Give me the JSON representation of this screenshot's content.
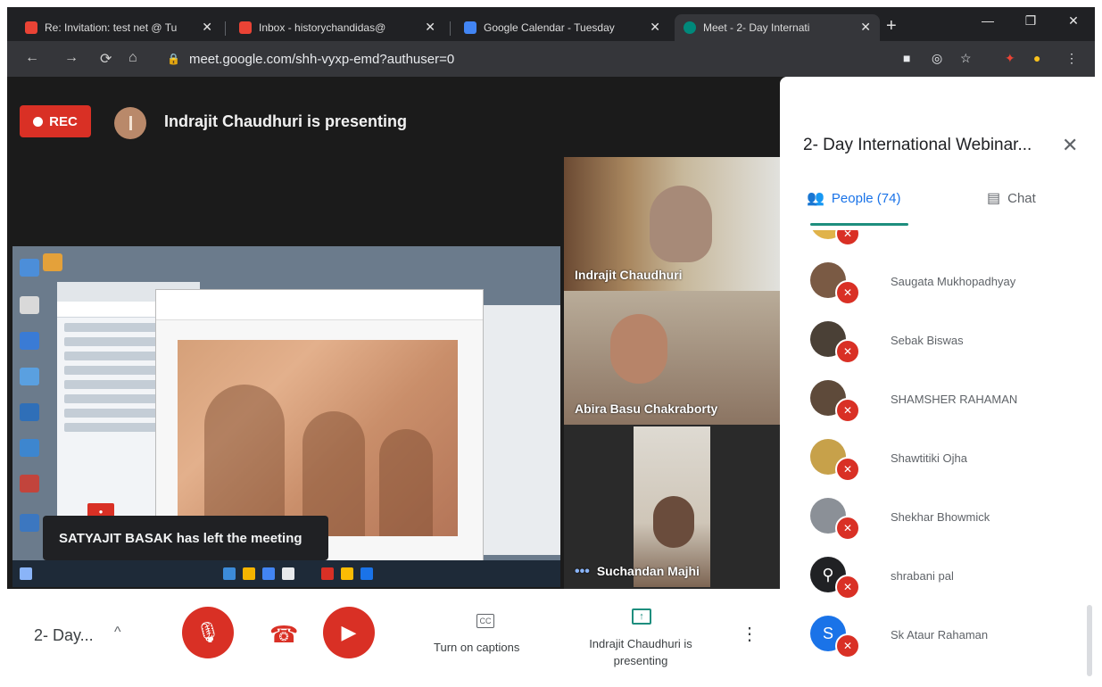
{
  "browser": {
    "tabs": [
      {
        "title": "Re: Invitation: test net @ Tu",
        "icon": "gmail-icon",
        "color": "#ea4335"
      },
      {
        "title": "Inbox - historychandidas@",
        "icon": "gmail-icon",
        "color": "#ea4335"
      },
      {
        "title": "Google Calendar - Tuesday",
        "icon": "calendar-icon",
        "color": "#4285f4"
      },
      {
        "title": "Meet - 2- Day Internati",
        "icon": "meet-icon",
        "color": "#00897b"
      }
    ],
    "url": "meet.google.com/shh-vyxp-emd?authuser=0"
  },
  "meet": {
    "rec_label": "REC",
    "presenting_banner": "Indrajit Chaudhuri is presenting",
    "toast": "SATYAJIT BASAK has left the meeting",
    "tiles": [
      {
        "name": "Indrajit Chaudhuri"
      },
      {
        "name": "Abira Basu Chakraborty"
      },
      {
        "name": "Suchandan Majhi"
      }
    ],
    "bottom": {
      "meeting_name": "2- Day...",
      "captions_label": "Turn on captions",
      "presenting_label": "Indrajit Chaudhuri is presenting"
    }
  },
  "panel": {
    "title": "2- Day International Webinar...",
    "people_tab": "People (74)",
    "chat_tab": "Chat",
    "people": [
      {
        "name": "Saugata Mukhopadhyay",
        "avatar_color": "#7a5a44",
        "initial": ""
      },
      {
        "name": "Sebak Biswas",
        "avatar_color": "#4a4036",
        "initial": ""
      },
      {
        "name": "SHAMSHER RAHAMAN",
        "avatar_color": "#5e4a3a",
        "initial": ""
      },
      {
        "name": "Shawtitiki Ojha",
        "avatar_color": "#c7a14a",
        "initial": ""
      },
      {
        "name": "Shekhar Bhowmick",
        "avatar_color": "#8b9097",
        "initial": ""
      },
      {
        "name": "shrabani pal",
        "avatar_color": "#202124",
        "initial": ""
      },
      {
        "name": "Sk Ataur Rahaman",
        "avatar_color": "#1a73e8",
        "initial": "S"
      }
    ]
  },
  "colors": {
    "accent_red": "#d93025",
    "accent_teal": "#1e8e7e",
    "accent_blue": "#1a73e8"
  }
}
